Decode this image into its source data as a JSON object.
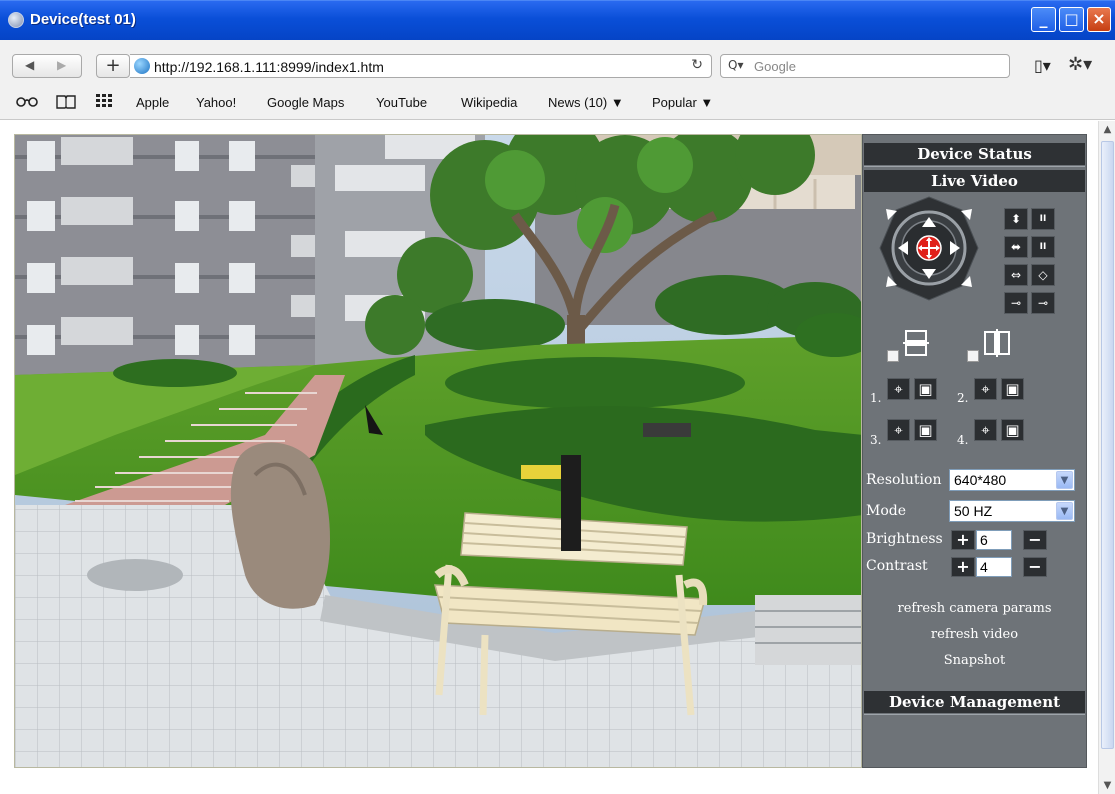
{
  "window": {
    "title": "Device(test 01)",
    "controls": {
      "minimize": "_",
      "maximize": "□",
      "close": "×"
    }
  },
  "toolbar": {
    "back_icon": "◀",
    "forward_icon": "▶",
    "add_icon": "+",
    "url": "http://192.168.1.111:8999/index1.htm",
    "reload_icon": "↻",
    "search_icon": "Q▾",
    "search_placeholder": "Google",
    "page_menu_icon": "▯▾",
    "settings_icon": "✲▾"
  },
  "bookmarks": {
    "icons": [
      "reader-icon",
      "bookmarks-icon",
      "top-sites-icon"
    ],
    "items": [
      "Apple",
      "Yahoo!",
      "Google Maps",
      "YouTube",
      "Wikipedia",
      "News (10) ▼",
      "Popular ▼"
    ]
  },
  "panel": {
    "device_status": "Device Status",
    "live_video": "Live Video",
    "ptz_buttons": {
      "patrol_vertical": "⬍",
      "stop_vertical": "II",
      "patrol_horizontal": "⬌",
      "stop_horizontal": "II",
      "flip": "⇔",
      "mirror": "◇",
      "io_on": "⊸",
      "io_off": "⊸"
    },
    "checkbox_icons": [
      "flip-icon",
      "mirror-icon"
    ],
    "presets": [
      {
        "num": "1.",
        "go": "⌖",
        "set": "▣"
      },
      {
        "num": "2.",
        "go": "⌖",
        "set": "▣"
      },
      {
        "num": "3.",
        "go": "⌖",
        "set": "▣"
      },
      {
        "num": "4.",
        "go": "⌖",
        "set": "▣"
      }
    ],
    "resolution": {
      "label": "Resolution",
      "value": "640*480"
    },
    "mode": {
      "label": "Mode",
      "value": "50 HZ"
    },
    "brightness": {
      "label": "Brightness",
      "value": "6",
      "plus": "+",
      "minus": "−"
    },
    "contrast": {
      "label": "Contrast",
      "value": "4",
      "plus": "+",
      "minus": "−"
    },
    "links": {
      "refresh_params": "refresh camera params",
      "refresh_video": "refresh video",
      "snapshot": "Snapshot"
    },
    "device_management": "Device Management"
  },
  "colors": {
    "titlebar": "#0a4fd8",
    "panel_bg": "#6e7378",
    "panel_header": "#2e3134",
    "ptz_center": "#e0201a"
  }
}
